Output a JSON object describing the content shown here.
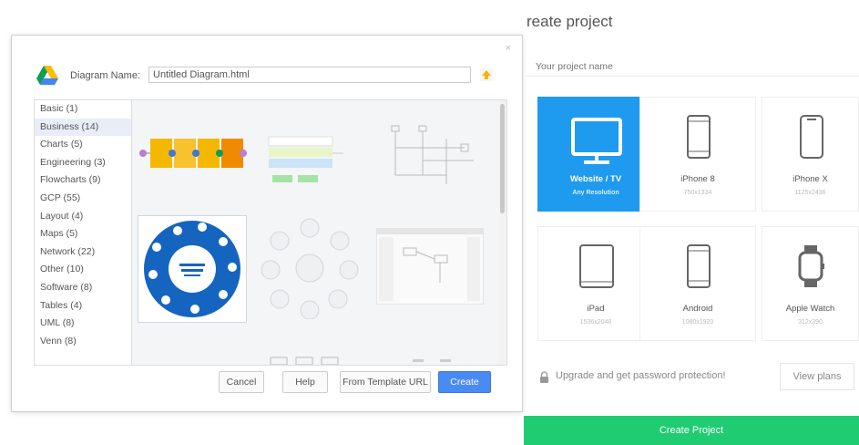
{
  "dialog": {
    "name_label": "Diagram Name:",
    "name_value": "Untitled Diagram.html",
    "close_glyph": "×",
    "categories": [
      {
        "label": "Basic (1)"
      },
      {
        "label": "Business (14)"
      },
      {
        "label": "Charts (5)"
      },
      {
        "label": "Engineering (3)"
      },
      {
        "label": "Flowcharts (9)"
      },
      {
        "label": "GCP (55)"
      },
      {
        "label": "Layout (4)"
      },
      {
        "label": "Maps (5)"
      },
      {
        "label": "Network (22)"
      },
      {
        "label": "Other (10)"
      },
      {
        "label": "Software (8)"
      },
      {
        "label": "Tables (4)"
      },
      {
        "label": "UML (8)"
      },
      {
        "label": "Venn (8)"
      }
    ],
    "selected_category": "Business (14)",
    "buttons": {
      "cancel": "Cancel",
      "help": "Help",
      "from_template_url": "From Template URL",
      "create": "Create"
    },
    "icons": [
      "google-drive-icon",
      "upload-icon",
      "close-icon"
    ],
    "accent_color": "#4a8af4"
  },
  "create_project": {
    "title": "reate project",
    "name_placeholder": "Your project name",
    "devices": [
      {
        "label": "Website / TV",
        "sub": "Any Resolution",
        "icon": "monitor-icon",
        "active": true
      },
      {
        "label": "iPhone 8",
        "sub": "750x1334",
        "icon": "phone-icon",
        "active": false
      },
      {
        "label": "iPhone X",
        "sub": "1125x2436",
        "icon": "phone-x-icon",
        "active": false
      },
      {
        "label": "iPad",
        "sub": "1536x2048",
        "icon": "tablet-icon",
        "active": false
      },
      {
        "label": "Android",
        "sub": "1080x1920",
        "icon": "android-phone-icon",
        "active": false
      },
      {
        "label": "Apple Watch",
        "sub": "312x390",
        "icon": "watch-icon",
        "active": false
      }
    ],
    "upgrade_text": "Upgrade and get password protection!",
    "view_plans": "View plans",
    "create_button": "Create Project",
    "colors": {
      "active_card": "#1e9aee",
      "create_button": "#1fcc72"
    }
  }
}
